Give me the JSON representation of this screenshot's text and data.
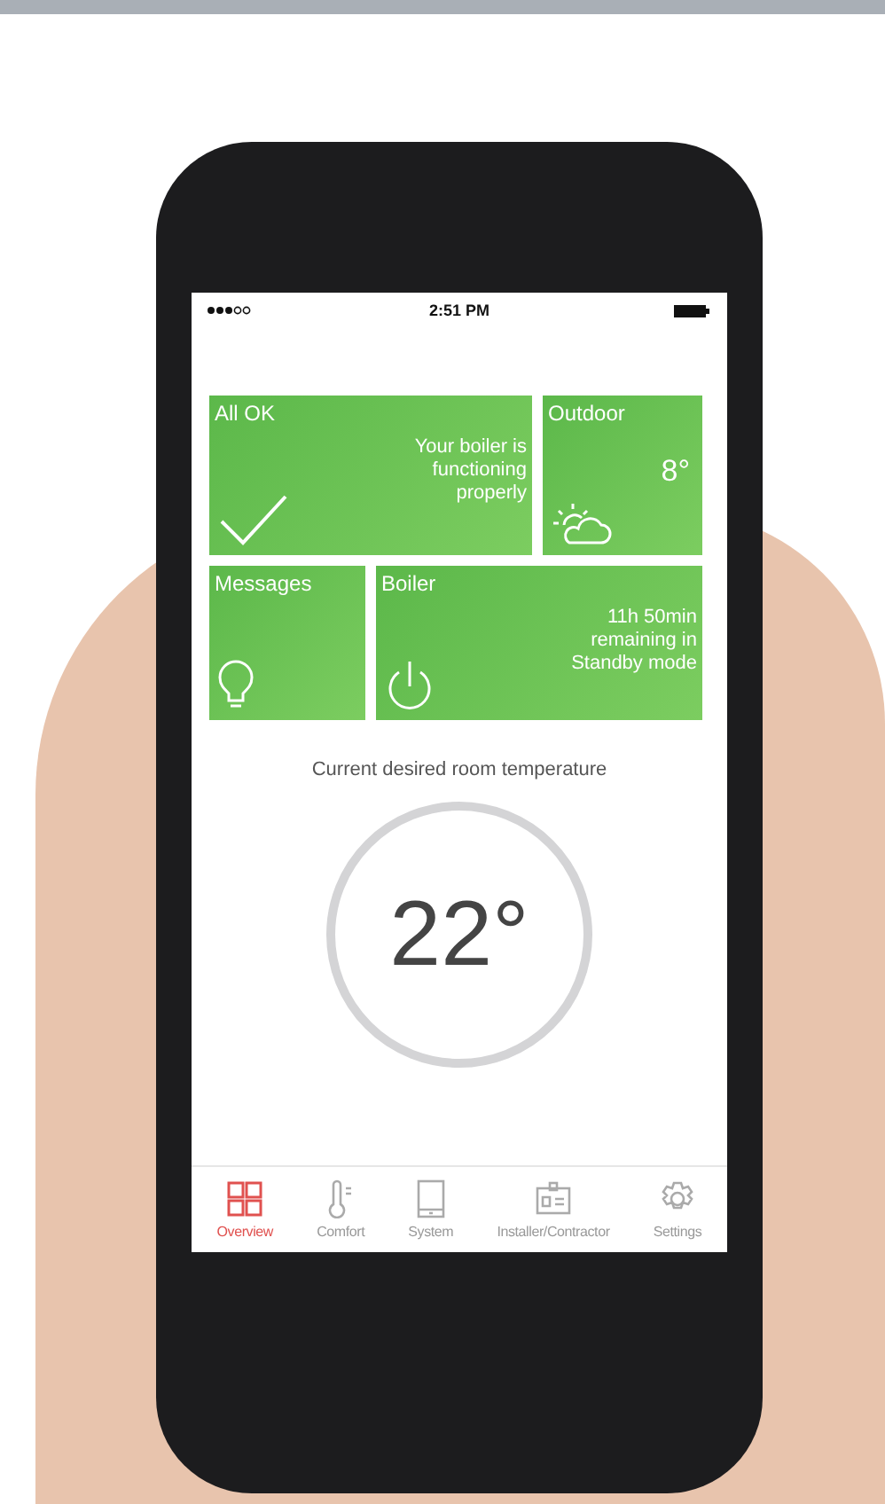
{
  "status_bar": {
    "time": "2:51 PM"
  },
  "tiles": [
    {
      "kind": "status",
      "title": "All OK",
      "text": "Your boiler is functioning properly"
    },
    {
      "kind": "outdoor",
      "title": "Outdoor",
      "value": "8°"
    },
    {
      "kind": "messages",
      "title": "Messages"
    },
    {
      "kind": "boiler",
      "title": "Boiler",
      "text": "11h 50min remaining in Standby mode"
    }
  ],
  "temperature": {
    "label": "Current desired room temperature",
    "value": "22°"
  },
  "tabs": [
    {
      "label": "Overview",
      "selected": true
    },
    {
      "label": "Comfort",
      "selected": false
    },
    {
      "label": "System",
      "selected": false
    },
    {
      "label": "Installer/Contractor",
      "selected": false
    },
    {
      "label": "Settings",
      "selected": false
    }
  ]
}
